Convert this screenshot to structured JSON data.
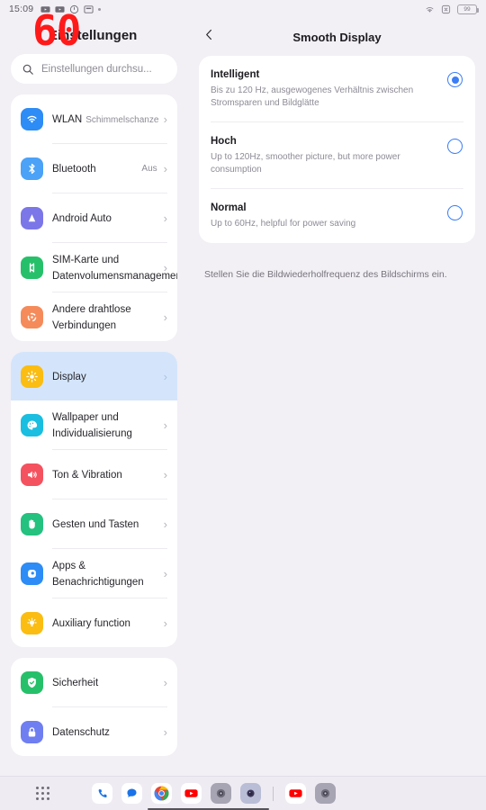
{
  "statusbar": {
    "clock": "15:09",
    "battery_level": "99",
    "left_icons": [
      "youtube-notification-icon",
      "youtube-notification-icon",
      "timer-icon",
      "screenshot-icon",
      "more-notifications-dot"
    ],
    "right_icons": [
      "wifi-icon",
      "no-sim-icon",
      "battery-icon"
    ]
  },
  "fps_overlay": {
    "value": "60",
    "color": "#ff1a1a"
  },
  "sidebar": {
    "title": "Einstellungen",
    "search": {
      "placeholder": "Einstellungen durchsu...",
      "icon": "search-icon"
    },
    "groups": [
      {
        "items": [
          {
            "label": "WLAN",
            "sub": "Schimmelschanze",
            "value": "",
            "icon": "wifi-icon",
            "color": "#2d8cf5",
            "selected": false
          },
          {
            "label": "Bluetooth",
            "sub": "",
            "value": "Aus",
            "icon": "bluetooth-icon",
            "color": "#4ba2f7",
            "selected": false
          },
          {
            "label": "Android Auto",
            "sub": "",
            "value": "",
            "icon": "android-auto-icon",
            "color": "#7b77e8",
            "selected": false
          },
          {
            "label": "SIM-Karte und Datenvolumensmanagement",
            "sub": "",
            "value": "",
            "icon": "sim-card-icon",
            "color": "#27c06a",
            "selected": false
          },
          {
            "label": "Andere drahtlose Verbindungen",
            "sub": "",
            "value": "",
            "icon": "wireless-connections-icon",
            "color": "#f58b5a",
            "selected": false
          }
        ]
      },
      {
        "items": [
          {
            "label": "Display",
            "sub": "",
            "value": "",
            "icon": "brightness-icon",
            "color": "#fbbd12",
            "selected": true
          },
          {
            "label": "Wallpaper und Individualisierung",
            "sub": "",
            "value": "",
            "icon": "palette-icon",
            "color": "#19bee0",
            "selected": false
          },
          {
            "label": "Ton & Vibration",
            "sub": "",
            "value": "",
            "icon": "speaker-icon",
            "color": "#f4525f",
            "selected": false
          },
          {
            "label": "Gesten und Tasten",
            "sub": "",
            "value": "",
            "icon": "hand-gesture-icon",
            "color": "#24c17f",
            "selected": false
          },
          {
            "label": "Apps & Benachrichtigungen",
            "sub": "",
            "value": "",
            "icon": "apps-icon",
            "color": "#2d8cf5",
            "selected": false
          },
          {
            "label": "Auxiliary function",
            "sub": "",
            "value": "",
            "icon": "accessibility-bulb-icon",
            "color": "#fbbd12",
            "selected": false
          }
        ]
      },
      {
        "items": [
          {
            "label": "Sicherheit",
            "sub": "",
            "value": "",
            "icon": "shield-check-icon",
            "color": "#27c06a",
            "selected": false
          },
          {
            "label": "Datenschutz",
            "sub": "",
            "value": "",
            "icon": "lock-icon",
            "color": "#6f7ef0",
            "selected": false
          }
        ]
      }
    ]
  },
  "detail": {
    "back_icon": "chevron-left-icon",
    "title": "Smooth Display",
    "options": [
      {
        "name": "Intelligent",
        "desc": "Bis zu 120 Hz, ausgewogenes Verhältnis zwischen Stromsparen und Bildglätte",
        "selected": true
      },
      {
        "name": "Hoch",
        "desc": "Up to 120Hz, smoother picture, but more power consumption",
        "selected": false
      },
      {
        "name": "Normal",
        "desc": "Up to 60Hz, helpful for power saving",
        "selected": false
      }
    ],
    "footer": "Stellen Sie die Bildwiederholfrequenz des Bildschirms ein.",
    "accent_color": "#3b7ef5"
  },
  "taskbar": {
    "drawer_icon": "app-drawer-icon",
    "dock_apps": [
      {
        "name": "phone-app-icon"
      },
      {
        "name": "messages-app-icon"
      },
      {
        "name": "chrome-app-icon"
      },
      {
        "name": "youtube-app-icon"
      },
      {
        "name": "camera-app-icon"
      },
      {
        "name": "camera-app-icon"
      }
    ],
    "recent_apps": [
      {
        "name": "youtube-app-icon"
      },
      {
        "name": "camera-app-icon"
      }
    ]
  }
}
